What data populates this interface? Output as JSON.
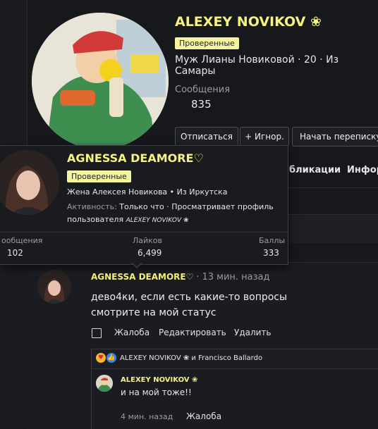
{
  "profile": {
    "name": "ALEXEY NOVIKOV ❀",
    "badge": "Проверенные",
    "blurb": "Муж Лианы Новиковой · 20 · Из Самары",
    "messages_label": "Сообщения",
    "messages_value": "835",
    "unfollow_label": "Отписаться",
    "ignore_label": "+ Игнор.",
    "start_chat_label": "Начать переписку"
  },
  "tabs": {
    "publications": "бликации",
    "info": "Инфор"
  },
  "popover": {
    "name": "AGNESSA DEAMORE♡",
    "badge": "Проверенные",
    "blurb": "Жена Алексея Новикова • Из Иркутска",
    "activity_label": "Активность:",
    "activity_value": "Только что · Просматривает профиль",
    "activity_value2": "пользователя",
    "activity_user": "ALEXEY NOVIKOV ❀",
    "stats": [
      {
        "label": "ообщения",
        "value": "102"
      },
      {
        "label": "Лайков",
        "value": "6,499"
      },
      {
        "label": "Баллы",
        "value": "333"
      }
    ]
  },
  "post": {
    "author": "AGNESSA DEAMORE♡",
    "time": "· 13 мин. назад",
    "text_line1": "дево4ки, если есть какие-то вопросы",
    "text_line2": "смотрите на мой статус",
    "report_label": "Жалоба",
    "edit_label": "Редактировать",
    "delete_label": "Удалить",
    "reactions_text": "ALEXEY NOVIKOV ❀ и Francisco Ballardo",
    "reply": {
      "author": "ALEXEY NOVIKOV ❀",
      "text": "и на мой тоже!!",
      "time": "4 мин. назад",
      "report_label": "Жалоба"
    }
  }
}
